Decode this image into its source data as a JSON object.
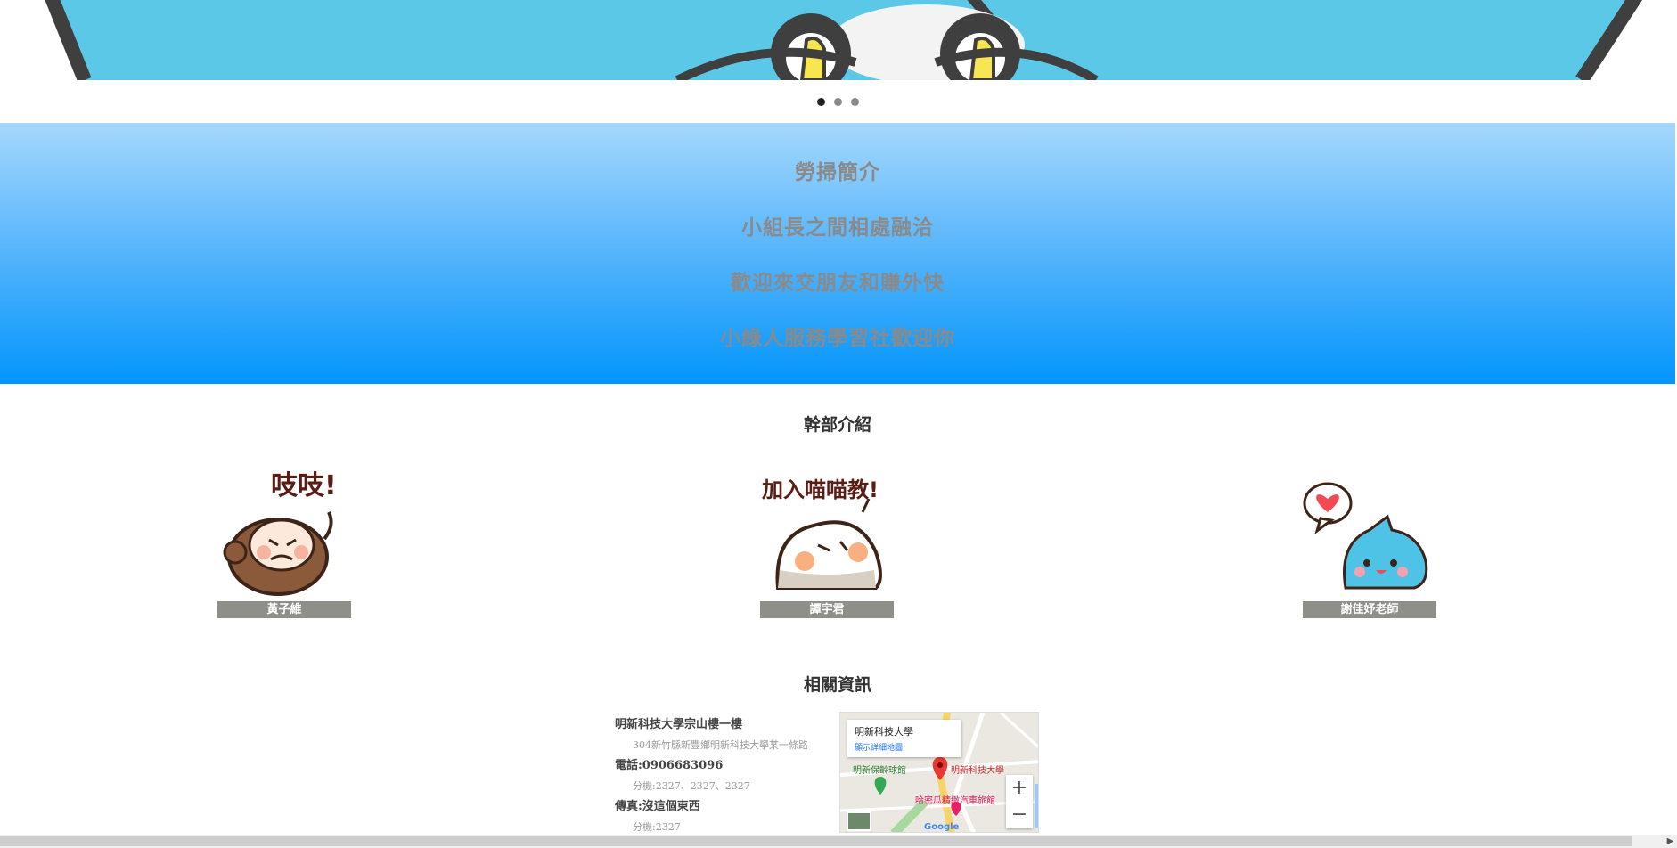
{
  "carousel": {
    "slides": 3,
    "active_index": 0,
    "dot_labels": [
      "slide-1",
      "slide-2",
      "slide-3"
    ]
  },
  "intro": {
    "lines": [
      "勞掃簡介",
      "小組長之間相處融洽",
      "歡迎來交朋友和賺外快",
      "小綠人服務學習社歡迎你"
    ]
  },
  "cadre": {
    "title": "幹部介紹",
    "members": [
      {
        "name": "黃子維",
        "image": "monkey-sticker"
      },
      {
        "name": "譚宇君",
        "image": "cat-sticker"
      },
      {
        "name": "謝佳妤老師",
        "image": "blue-cat-sticker"
      }
    ],
    "sticker_text": [
      "吱吱!",
      "加入喵喵教!"
    ]
  },
  "related": {
    "title": "相關資訊",
    "address_title": "明新科技大學宗山樓一樓",
    "address_detail": "304新竹縣新豐鄉明新科技大學某一條路",
    "phone": "電話:0906683096",
    "phone_ext": "分機:2327、2327、2327",
    "fax": "傳真:沒這個東西",
    "fax_ext": "分機:2327"
  },
  "map": {
    "card_title": "明新科技大學",
    "card_link": "顯示詳細地圖",
    "labels": [
      "明新保齡球館",
      "明新科技大學",
      "哈密瓜精緻汽車旅館"
    ],
    "zoom_in": "+",
    "zoom_out": "−",
    "brand": "Google"
  },
  "colors": {
    "intro_top": "#a5d8fd",
    "intro_bottom": "#0395fc",
    "name_bar": "#8f8f8a"
  }
}
